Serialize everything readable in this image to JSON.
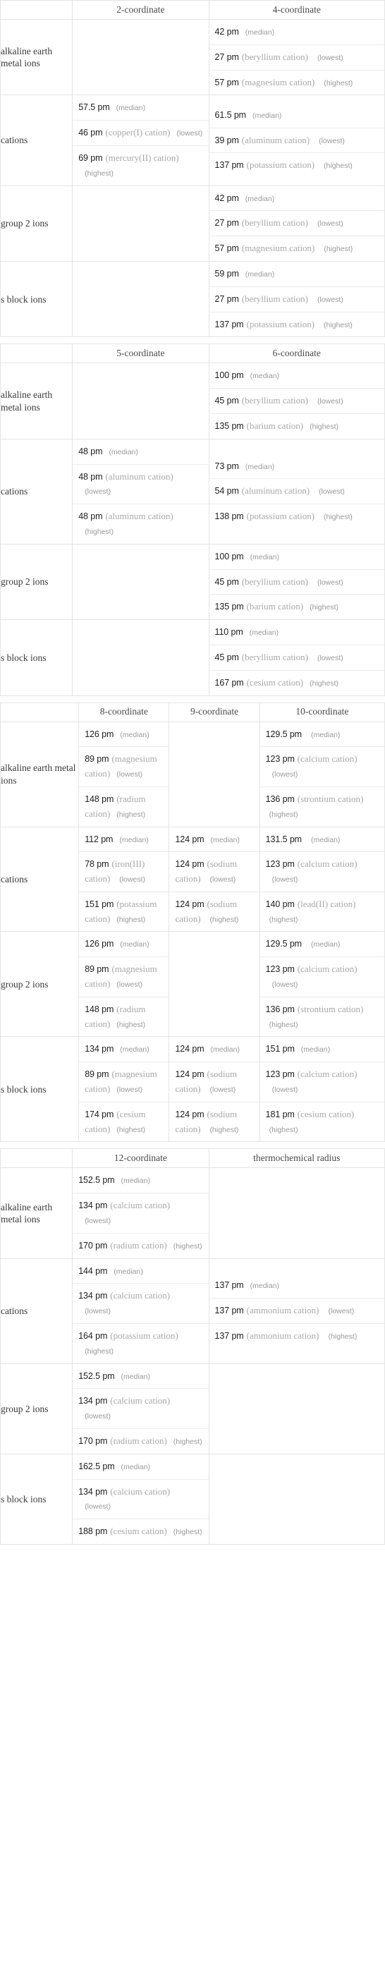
{
  "tables": [
    {
      "name": "coordination-2-4",
      "columns": [
        "",
        "2-coordinate",
        "4-coordinate"
      ],
      "rows": [
        {
          "label": "alkaline earth metal ions",
          "cells": [
            {
              "entries": []
            },
            {
              "entries": [
                {
                  "value": "42 pm",
                  "species": "",
                  "qualifier": "(median)",
                  "inline": true
                },
                {
                  "value": "27 pm",
                  "species": "(beryllium cation)",
                  "qualifier": "(lowest)",
                  "inline": false
                },
                {
                  "value": "57 pm",
                  "species": "(magnesium cation)",
                  "qualifier": "(highest)",
                  "inline": false
                }
              ]
            }
          ]
        },
        {
          "label": "cations",
          "cells": [
            {
              "entries": [
                {
                  "value": "57.5 pm",
                  "species": "",
                  "qualifier": "(median)",
                  "inline": true
                },
                {
                  "value": "46 pm",
                  "species": "(copper(I) cation)",
                  "qualifier": "(lowest)",
                  "inline": true
                },
                {
                  "value": "69 pm",
                  "species": "(mercury(II) cation)",
                  "qualifier": "(highest)",
                  "inline": false
                }
              ]
            },
            {
              "entries": [
                {
                  "value": "61.5 pm",
                  "species": "",
                  "qualifier": "(median)",
                  "inline": true
                },
                {
                  "value": "39 pm",
                  "species": "(aluminum cation)",
                  "qualifier": "(lowest)",
                  "inline": false
                },
                {
                  "value": "137 pm",
                  "species": "(potassium cation)",
                  "qualifier": "(highest)",
                  "inline": false
                }
              ]
            }
          ]
        },
        {
          "label": "group 2 ions",
          "cells": [
            {
              "entries": []
            },
            {
              "entries": [
                {
                  "value": "42 pm",
                  "species": "",
                  "qualifier": "(median)",
                  "inline": true
                },
                {
                  "value": "27 pm",
                  "species": "(beryllium cation)",
                  "qualifier": "(lowest)",
                  "inline": false
                },
                {
                  "value": "57 pm",
                  "species": "(magnesium cation)",
                  "qualifier": "(highest)",
                  "inline": false
                }
              ]
            }
          ]
        },
        {
          "label": "s block ions",
          "cells": [
            {
              "entries": []
            },
            {
              "entries": [
                {
                  "value": "59 pm",
                  "species": "",
                  "qualifier": "(median)",
                  "inline": true
                },
                {
                  "value": "27 pm",
                  "species": "(beryllium cation)",
                  "qualifier": "(lowest)",
                  "inline": false
                },
                {
                  "value": "137 pm",
                  "species": "(potassium cation)",
                  "qualifier": "(highest)",
                  "inline": false
                }
              ]
            }
          ]
        }
      ]
    },
    {
      "name": "coordination-5-6",
      "columns": [
        "",
        "5-coordinate",
        "6-coordinate"
      ],
      "rows": [
        {
          "label": "alkaline earth metal ions",
          "cells": [
            {
              "entries": []
            },
            {
              "entries": [
                {
                  "value": "100 pm",
                  "species": "",
                  "qualifier": "(median)",
                  "inline": true
                },
                {
                  "value": "45 pm",
                  "species": "(beryllium cation)",
                  "qualifier": "(lowest)",
                  "inline": false
                },
                {
                  "value": "135 pm",
                  "species": "(barium cation)",
                  "qualifier": "(highest)",
                  "inline": true
                }
              ]
            }
          ]
        },
        {
          "label": "cations",
          "cells": [
            {
              "entries": [
                {
                  "value": "48 pm",
                  "species": "",
                  "qualifier": "(median)",
                  "inline": true
                },
                {
                  "value": "48 pm",
                  "species": "(aluminum cation)",
                  "qualifier": "(lowest)",
                  "inline": false
                },
                {
                  "value": "48 pm",
                  "species": "(aluminum cation)",
                  "qualifier": "(highest)",
                  "inline": false
                }
              ]
            },
            {
              "entries": [
                {
                  "value": "73 pm",
                  "species": "",
                  "qualifier": "(median)",
                  "inline": true
                },
                {
                  "value": "54 pm",
                  "species": "(aluminum cation)",
                  "qualifier": "(lowest)",
                  "inline": false
                },
                {
                  "value": "138 pm",
                  "species": "(potassium cation)",
                  "qualifier": "(highest)",
                  "inline": false
                }
              ]
            }
          ]
        },
        {
          "label": "group 2 ions",
          "cells": [
            {
              "entries": []
            },
            {
              "entries": [
                {
                  "value": "100 pm",
                  "species": "",
                  "qualifier": "(median)",
                  "inline": true
                },
                {
                  "value": "45 pm",
                  "species": "(beryllium cation)",
                  "qualifier": "(lowest)",
                  "inline": false
                },
                {
                  "value": "135 pm",
                  "species": "(barium cation)",
                  "qualifier": "(highest)",
                  "inline": true
                }
              ]
            }
          ]
        },
        {
          "label": "s block ions",
          "cells": [
            {
              "entries": []
            },
            {
              "entries": [
                {
                  "value": "110 pm",
                  "species": "",
                  "qualifier": "(median)",
                  "inline": true
                },
                {
                  "value": "45 pm",
                  "species": "(beryllium cation)",
                  "qualifier": "(lowest)",
                  "inline": false
                },
                {
                  "value": "167 pm",
                  "species": "(cesium cation)",
                  "qualifier": "(highest)",
                  "inline": true
                }
              ]
            }
          ]
        }
      ]
    },
    {
      "name": "coordination-8-9-10",
      "columns": [
        "",
        "8-coordinate",
        "9-coordinate",
        "10-coordinate"
      ],
      "rows": [
        {
          "label": "alkaline earth metal ions",
          "cells": [
            {
              "entries": [
                {
                  "value": "126 pm",
                  "species": "",
                  "qualifier": "(median)",
                  "inline": true
                },
                {
                  "value": "89 pm",
                  "species": "(magnesium cation)",
                  "qualifier": "(lowest)",
                  "inline": true
                },
                {
                  "value": "148 pm",
                  "species": "(radium cation)",
                  "qualifier": "(highest)",
                  "inline": true
                }
              ]
            },
            {
              "entries": []
            },
            {
              "entries": [
                {
                  "value": "129.5 pm",
                  "species": "",
                  "qualifier": "(median)",
                  "inline": false
                },
                {
                  "value": "123 pm",
                  "species": "(calcium cation)",
                  "qualifier": "(lowest)",
                  "inline": false
                },
                {
                  "value": "136 pm",
                  "species": "(strontium cation)",
                  "qualifier": "(highest)",
                  "inline": true
                }
              ]
            }
          ]
        },
        {
          "label": "cations",
          "cells": [
            {
              "entries": [
                {
                  "value": "112 pm",
                  "species": "",
                  "qualifier": "(median)",
                  "inline": true
                },
                {
                  "value": "78 pm",
                  "species": "(iron(III) cation)",
                  "qualifier": "(lowest)",
                  "inline": false
                },
                {
                  "value": "151 pm",
                  "species": "(potassium cation)",
                  "qualifier": "(highest)",
                  "inline": true
                }
              ]
            },
            {
              "entries": [
                {
                  "value": "124 pm",
                  "species": "",
                  "qualifier": "(median)",
                  "inline": true
                },
                {
                  "value": "124 pm",
                  "species": "(sodium cation)",
                  "qualifier": "(lowest)",
                  "inline": false
                },
                {
                  "value": "124 pm",
                  "species": "(sodium cation)",
                  "qualifier": "(highest)",
                  "inline": false
                }
              ]
            },
            {
              "entries": [
                {
                  "value": "131.5 pm",
                  "species": "",
                  "qualifier": "(median)",
                  "inline": false
                },
                {
                  "value": "123 pm",
                  "species": "(calcium cation)",
                  "qualifier": "(lowest)",
                  "inline": false
                },
                {
                  "value": "140 pm",
                  "species": "(lead(II) cation)",
                  "qualifier": "(highest)",
                  "inline": true
                }
              ]
            }
          ]
        },
        {
          "label": "group 2 ions",
          "cells": [
            {
              "entries": [
                {
                  "value": "126 pm",
                  "species": "",
                  "qualifier": "(median)",
                  "inline": true
                },
                {
                  "value": "89 pm",
                  "species": "(magnesium cation)",
                  "qualifier": "(lowest)",
                  "inline": true
                },
                {
                  "value": "148 pm",
                  "species": "(radium cation)",
                  "qualifier": "(highest)",
                  "inline": true
                }
              ]
            },
            {
              "entries": []
            },
            {
              "entries": [
                {
                  "value": "129.5 pm",
                  "species": "",
                  "qualifier": "(median)",
                  "inline": false
                },
                {
                  "value": "123 pm",
                  "species": "(calcium cation)",
                  "qualifier": "(lowest)",
                  "inline": false
                },
                {
                  "value": "136 pm",
                  "species": "(strontium cation)",
                  "qualifier": "(highest)",
                  "inline": true
                }
              ]
            }
          ]
        },
        {
          "label": "s block ions",
          "cells": [
            {
              "entries": [
                {
                  "value": "134 pm",
                  "species": "",
                  "qualifier": "(median)",
                  "inline": true
                },
                {
                  "value": "89 pm",
                  "species": "(magnesium cation)",
                  "qualifier": "(lowest)",
                  "inline": true
                },
                {
                  "value": "174 pm",
                  "species": "(cesium cation)",
                  "qualifier": "(highest)",
                  "inline": true
                }
              ]
            },
            {
              "entries": [
                {
                  "value": "124 pm",
                  "species": "",
                  "qualifier": "(median)",
                  "inline": true
                },
                {
                  "value": "124 pm",
                  "species": "(sodium cation)",
                  "qualifier": "(lowest)",
                  "inline": false
                },
                {
                  "value": "124 pm",
                  "species": "(sodium cation)",
                  "qualifier": "(highest)",
                  "inline": false
                }
              ]
            },
            {
              "entries": [
                {
                  "value": "151 pm",
                  "species": "",
                  "qualifier": "(median)",
                  "inline": true
                },
                {
                  "value": "123 pm",
                  "species": "(calcium cation)",
                  "qualifier": "(lowest)",
                  "inline": false
                },
                {
                  "value": "181 pm",
                  "species": "(cesium cation)",
                  "qualifier": "(highest)",
                  "inline": true
                }
              ]
            }
          ]
        }
      ]
    },
    {
      "name": "coordination-12-thermochemical",
      "columns": [
        "",
        "12-coordinate",
        "thermochemical radius"
      ],
      "rows": [
        {
          "label": "alkaline earth metal ions",
          "cells": [
            {
              "entries": [
                {
                  "value": "152.5 pm",
                  "species": "",
                  "qualifier": "(median)",
                  "inline": true
                },
                {
                  "value": "134 pm",
                  "species": "(calcium cation)",
                  "qualifier": "(lowest)",
                  "inline": false
                },
                {
                  "value": "170 pm",
                  "species": "(radium cation)",
                  "qualifier": "(highest)",
                  "inline": true
                }
              ]
            },
            {
              "entries": []
            }
          ]
        },
        {
          "label": "cations",
          "cells": [
            {
              "entries": [
                {
                  "value": "144 pm",
                  "species": "",
                  "qualifier": "(median)",
                  "inline": true
                },
                {
                  "value": "134 pm",
                  "species": "(calcium cation)",
                  "qualifier": "(lowest)",
                  "inline": false
                },
                {
                  "value": "164 pm",
                  "species": "(potassium cation)",
                  "qualifier": "(highest)",
                  "inline": false
                }
              ]
            },
            {
              "entries": [
                {
                  "value": "137 pm",
                  "species": "",
                  "qualifier": "(median)",
                  "inline": true
                },
                {
                  "value": "137 pm",
                  "species": "(ammonium cation)",
                  "qualifier": "(lowest)",
                  "inline": false
                },
                {
                  "value": "137 pm",
                  "species": "(ammonium cation)",
                  "qualifier": "(highest)",
                  "inline": false
                }
              ]
            }
          ]
        },
        {
          "label": "group 2 ions",
          "cells": [
            {
              "entries": [
                {
                  "value": "152.5 pm",
                  "species": "",
                  "qualifier": "(median)",
                  "inline": true
                },
                {
                  "value": "134 pm",
                  "species": "(calcium cation)",
                  "qualifier": "(lowest)",
                  "inline": false
                },
                {
                  "value": "170 pm",
                  "species": "(radium cation)",
                  "qualifier": "(highest)",
                  "inline": true
                }
              ]
            },
            {
              "entries": []
            }
          ]
        },
        {
          "label": "s block ions",
          "cells": [
            {
              "entries": [
                {
                  "value": "162.5 pm",
                  "species": "",
                  "qualifier": "(median)",
                  "inline": true
                },
                {
                  "value": "134 pm",
                  "species": "(calcium cation)",
                  "qualifier": "(lowest)",
                  "inline": false
                },
                {
                  "value": "188 pm",
                  "species": "(cesium cation)",
                  "qualifier": "(highest)",
                  "inline": true
                }
              ]
            },
            {
              "entries": []
            }
          ]
        }
      ]
    }
  ],
  "layout": {
    "col_widths_3": [
      "102px",
      "193px",
      "249px"
    ],
    "col_widths_4": [
      "111px",
      "128px",
      "128px",
      "177px"
    ]
  }
}
